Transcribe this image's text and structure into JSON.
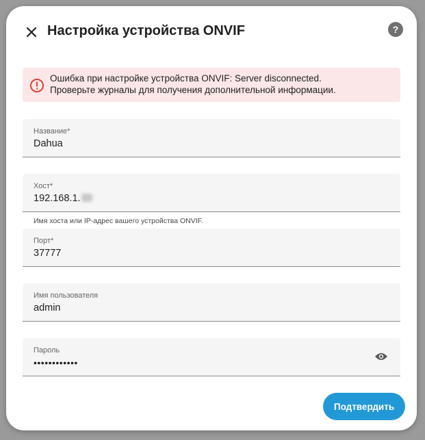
{
  "dialog": {
    "title": "Настройка устройства ONVIF",
    "help_label": "?"
  },
  "alert": {
    "line1": "Ошибка при настройке устройства ONVIF: Server disconnected.",
    "line2": "Проверьте журналы для получения дополнительной информации.",
    "color": "#db4437"
  },
  "fields": {
    "name": {
      "label": "Название*",
      "value": "Dahua"
    },
    "host": {
      "label": "Хост*",
      "value": "192.168.1.",
      "helper": "Имя хоста или IP-адрес вашего устройства ONVIF."
    },
    "port": {
      "label": "Порт*",
      "value": "37777"
    },
    "username": {
      "label": "Имя пользователя",
      "value": "admin"
    },
    "password": {
      "label": "Пароль",
      "value": "••••••••••••"
    }
  },
  "submit_label": "Подтвердить",
  "colors": {
    "accent": "#2398d6",
    "alert_bg": "#fbe7e8"
  }
}
